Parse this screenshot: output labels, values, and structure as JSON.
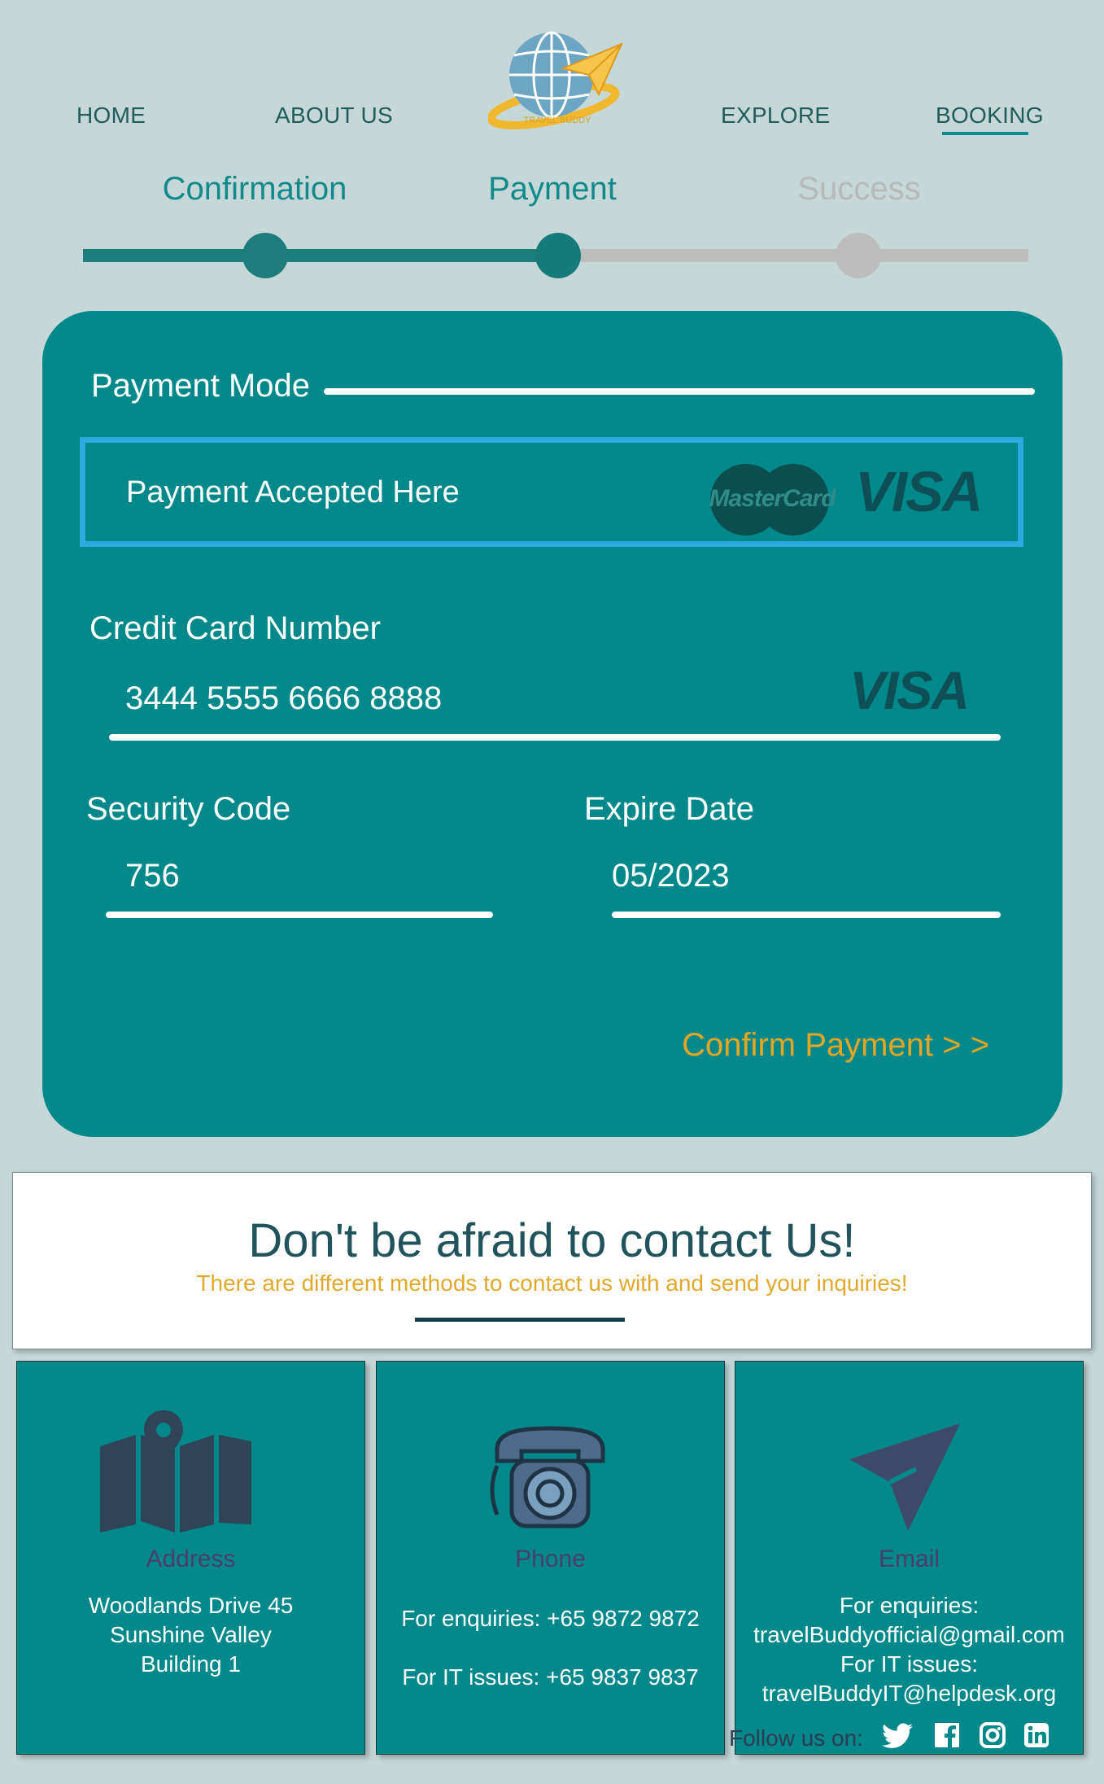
{
  "nav": {
    "home": "HOME",
    "about": "ABOUT US",
    "explore": "EXPLORE",
    "booking": "BOOKING",
    "logo_text": "TRAVEL BUDDY",
    "active": "BOOKING"
  },
  "stepper": {
    "steps": [
      {
        "label": "Confirmation",
        "state": "done"
      },
      {
        "label": "Payment",
        "state": "current"
      },
      {
        "label": "Success",
        "state": "pending"
      }
    ]
  },
  "payment": {
    "section_title": "Payment Mode",
    "accepted_label": "Payment Accepted Here",
    "mastercard_label": "MasterCard",
    "visa_label": "VISA",
    "card_number_label": "Credit Card Number",
    "card_number_value": "3444 5555 6666 8888",
    "security_code_label": "Security Code",
    "security_code_value": "756",
    "expire_date_label": "Expire Date",
    "expire_date_value": "05/2023",
    "confirm_label": "Confirm Payment > >"
  },
  "contact": {
    "title": "Don't be afraid to contact Us!",
    "subtitle": "There are different methods to contact us with and send your inquiries!",
    "address": {
      "title": "Address",
      "lines": [
        "Woodlands Drive 45",
        "Sunshine Valley",
        "Building 1"
      ]
    },
    "phone": {
      "title": "Phone",
      "enquiries": "For enquiries: +65 9872 9872",
      "it": "For IT issues: +65 9837 9837"
    },
    "email": {
      "title": "Email",
      "lines": [
        "For enquiries:",
        "travelBuddyofficial@gmail.com",
        "For IT issues:",
        "travelBuddyIT@helpdesk.org"
      ]
    },
    "follow_label": "Follow us on:"
  },
  "colors": {
    "teal": "#00888a",
    "dark_teal": "#1e5d5a",
    "gold": "#e6a623",
    "highlight_blue": "#29abe2",
    "background": "#c5d7d7"
  }
}
